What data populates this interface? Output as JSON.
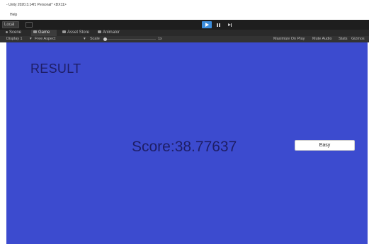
{
  "window": {
    "title": "- Unity 2020.3.14f1 Personal* <DX11>"
  },
  "menu": {
    "items": [
      "Help"
    ]
  },
  "toolbar": {
    "local_label": "Local",
    "play_icon": "play-icon",
    "pause_icon": "pause-icon",
    "step_icon": "step-icon"
  },
  "tabs": [
    {
      "label": "Scene",
      "icon": "scene-icon",
      "active": false
    },
    {
      "label": "Game",
      "icon": "game-icon",
      "active": true
    },
    {
      "label": "Asset Store",
      "icon": "asset-store-icon",
      "active": false
    },
    {
      "label": "Animator",
      "icon": "animator-icon",
      "active": false
    }
  ],
  "game_toolbar": {
    "display": "Display 1",
    "aspect": "Free Aspect",
    "scale_label": "Scale",
    "scale_value": "1x",
    "maximize": "Maximize On Play",
    "mute": "Mute Audio",
    "stats": "Stats",
    "gizmos": "Gizmos"
  },
  "game": {
    "background": "#3c4bcf",
    "text_color": "#1e1e66",
    "result_title": "RESULT",
    "score_text": "Score:38.77637",
    "easy_button_label": "Easy"
  }
}
